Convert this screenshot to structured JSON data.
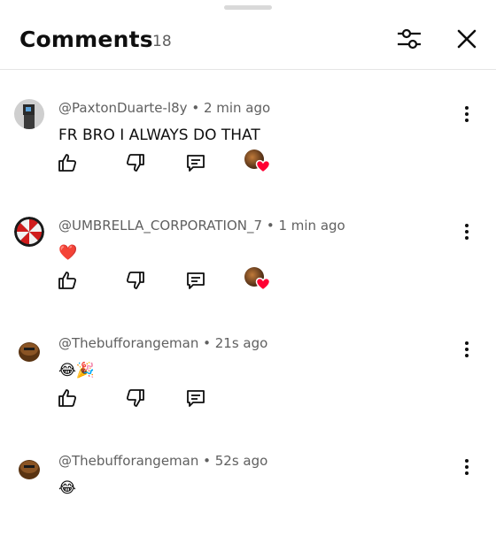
{
  "header": {
    "title": "Comments",
    "count": "18",
    "filter_icon": "sliders-icon",
    "close_icon": "close-icon"
  },
  "comments": [
    {
      "author": "@PaxtonDuarte-l8y",
      "time": "2 min ago",
      "text": "FR BRO I ALWAYS DO THAT",
      "creator_heart": true
    },
    {
      "author": "@UMBRELLA_CORPORATION_7",
      "time": "1 min ago",
      "text": "❤️",
      "creator_heart": true
    },
    {
      "author": "@Thebufforangeman",
      "time": "21s ago",
      "text": "😂🎉",
      "creator_heart": false
    },
    {
      "author": "@Thebufforangeman",
      "time": "52s ago",
      "text": "😂",
      "creator_heart": false
    }
  ],
  "colors": {
    "text": "#0f0f0f",
    "meta": "#606060",
    "heart": "#ff0033",
    "divider": "#e5e5e5"
  }
}
